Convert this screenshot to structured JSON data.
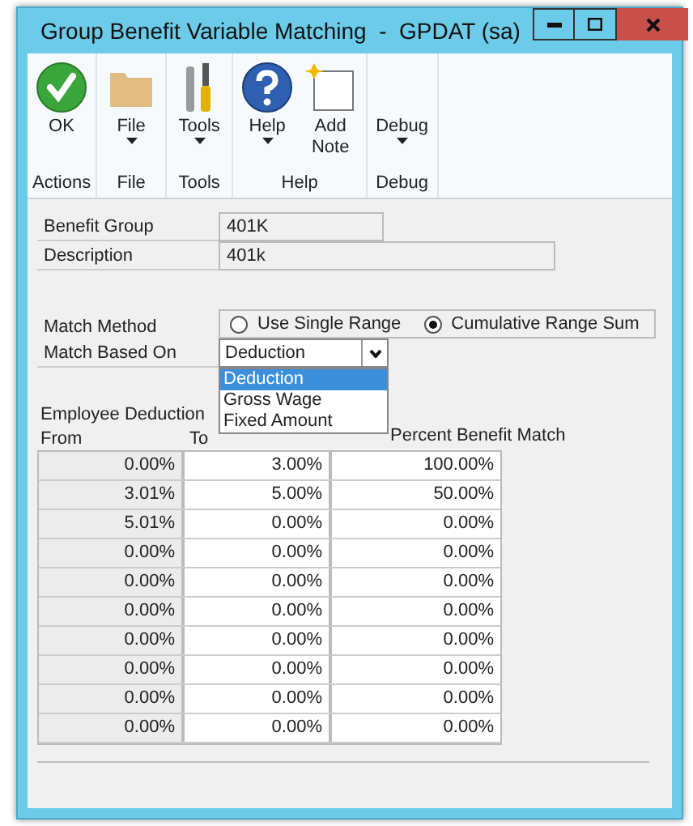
{
  "window": {
    "title": "Group Benefit Variable Matching  -  GPDAT (sa)"
  },
  "ribbon": {
    "groups": [
      {
        "label": "Actions",
        "buttons": [
          {
            "kind": "ok",
            "label": "OK",
            "has_menu": false
          }
        ]
      },
      {
        "label": "File",
        "buttons": [
          {
            "kind": "folder",
            "label": "File",
            "has_menu": true
          }
        ]
      },
      {
        "label": "Tools",
        "buttons": [
          {
            "kind": "tools",
            "label": "Tools",
            "has_menu": true
          }
        ]
      },
      {
        "label": "Help",
        "buttons": [
          {
            "kind": "help",
            "label": "Help",
            "has_menu": true
          },
          {
            "kind": "note",
            "label": "Add Note",
            "has_menu": false
          }
        ]
      },
      {
        "label": "Debug",
        "buttons": [
          {
            "kind": "none",
            "label": "Debug",
            "has_menu": true
          }
        ]
      }
    ]
  },
  "benefit_group": {
    "label": "Benefit Group",
    "value": "401K"
  },
  "description": {
    "label": "Description",
    "value": "401k"
  },
  "match_method": {
    "label": "Match Method",
    "options": [
      {
        "label": "Use Single Range",
        "selected": false
      },
      {
        "label": "Cumulative Range Sum",
        "selected": true
      }
    ]
  },
  "match_based_on": {
    "label": "Match Based On",
    "value": "Deduction",
    "options": [
      {
        "label": "Deduction",
        "selected": true
      },
      {
        "label": "Gross Wage",
        "selected": false
      },
      {
        "label": "Fixed Amount",
        "selected": false
      }
    ]
  },
  "table": {
    "group_label": "Employee Deduction",
    "columns": [
      "From",
      "To",
      "Percent Benefit Match"
    ],
    "rows": [
      [
        "0.00%",
        "3.00%",
        "100.00%"
      ],
      [
        "3.01%",
        "5.00%",
        "50.00%"
      ],
      [
        "5.01%",
        "0.00%",
        "0.00%"
      ],
      [
        "0.00%",
        "0.00%",
        "0.00%"
      ],
      [
        "0.00%",
        "0.00%",
        "0.00%"
      ],
      [
        "0.00%",
        "0.00%",
        "0.00%"
      ],
      [
        "0.00%",
        "0.00%",
        "0.00%"
      ],
      [
        "0.00%",
        "0.00%",
        "0.00%"
      ],
      [
        "0.00%",
        "0.00%",
        "0.00%"
      ],
      [
        "0.00%",
        "0.00%",
        "0.00%"
      ]
    ]
  }
}
